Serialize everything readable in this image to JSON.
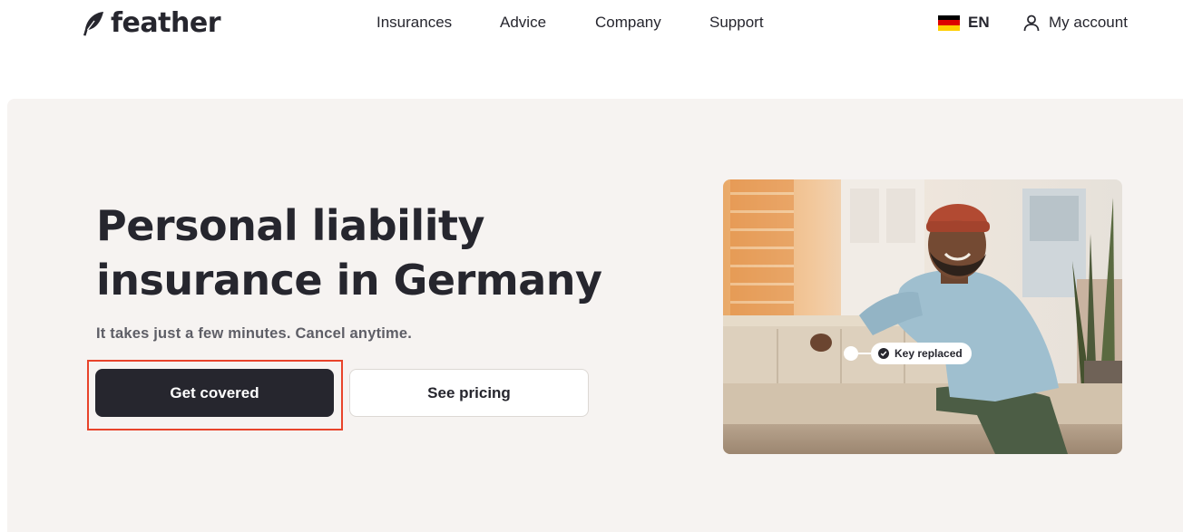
{
  "header": {
    "logo_text": "feather",
    "nav": [
      {
        "label": "Insurances"
      },
      {
        "label": "Advice"
      },
      {
        "label": "Company"
      },
      {
        "label": "Support"
      }
    ],
    "language": {
      "label": "EN",
      "flag": "germany-flag-icon"
    },
    "account": {
      "label": "My account",
      "icon": "user-icon"
    }
  },
  "hero": {
    "title": "Personal liability insurance in Germany",
    "subtitle": "It takes just a few minutes. Cancel anytime.",
    "primary_button": "Get covered",
    "secondary_button": "See pricing",
    "image_tag": "Key replaced"
  },
  "colors": {
    "text": "#26262e",
    "hero_background": "#f6f3f1",
    "primary_button": "#26262e",
    "highlight": "#e8432a"
  }
}
